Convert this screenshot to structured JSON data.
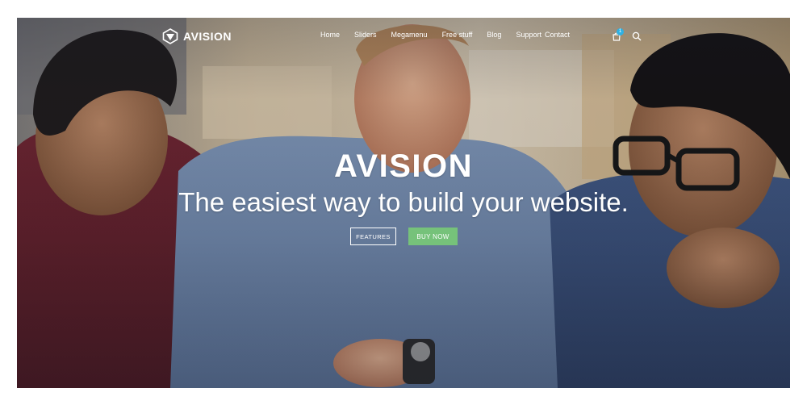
{
  "header": {
    "logo_text": "AVISION",
    "nav": [
      {
        "label": "Home"
      },
      {
        "label": "Sliders"
      },
      {
        "label": "Megamenu"
      },
      {
        "label": "Free stuff"
      },
      {
        "label": "Blog"
      },
      {
        "label": "Support"
      },
      {
        "label": "Contact"
      }
    ],
    "cart_count": "1",
    "icons": {
      "logo": "shield-logo-icon",
      "cart": "shopping-bag-icon",
      "search": "search-icon"
    }
  },
  "hero": {
    "title": "AVISION",
    "subtitle": "The easiest way to build your website.",
    "buttons": {
      "features_label": "FEATURES",
      "buy_label": "BUY NOW"
    }
  },
  "colors": {
    "buy_button": "#76c27a",
    "cart_badge": "#2fb1e3",
    "text": "#ffffff"
  }
}
